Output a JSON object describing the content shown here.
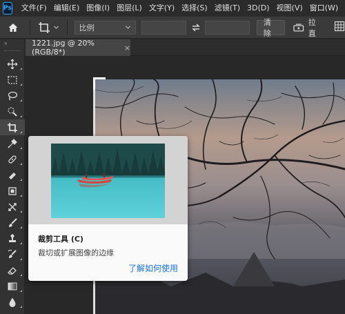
{
  "app": {
    "logo": "Ps"
  },
  "menu": [
    "文件(F)",
    "编辑(E)",
    "图像(I)",
    "图层(L)",
    "文字(Y)",
    "选择(S)",
    "滤镜(T)",
    "3D(D)",
    "视图(V)",
    "窗口(W)",
    "帮"
  ],
  "options": {
    "ratio_label": "比例",
    "width_value": "",
    "height_value": "",
    "clear_label": "清除",
    "straighten_label": "拉直"
  },
  "tab": {
    "title": "1221.jpg @ 20%(RGB/8*)",
    "close": "×"
  },
  "tools": [
    "move-tool",
    "marquee-tool",
    "lasso-tool",
    "quick-select-tool",
    "crop-tool",
    "eyedropper-tool",
    "healing-brush-tool",
    "brush-tool",
    "clone-stamp-tool",
    "history-brush-tool",
    "eraser-tool",
    "gradient-tool",
    "blur-tool"
  ],
  "tooltip": {
    "title": "裁剪工具 (C)",
    "description": "裁切或扩展图像的边缘",
    "link": "了解如何使用"
  },
  "colors": {
    "accent": "#1473e6",
    "ps_blue": "#31a8ff",
    "menubar": "#2b2b2b",
    "optbar": "#3a3a3a",
    "toolbar": "#323232"
  }
}
